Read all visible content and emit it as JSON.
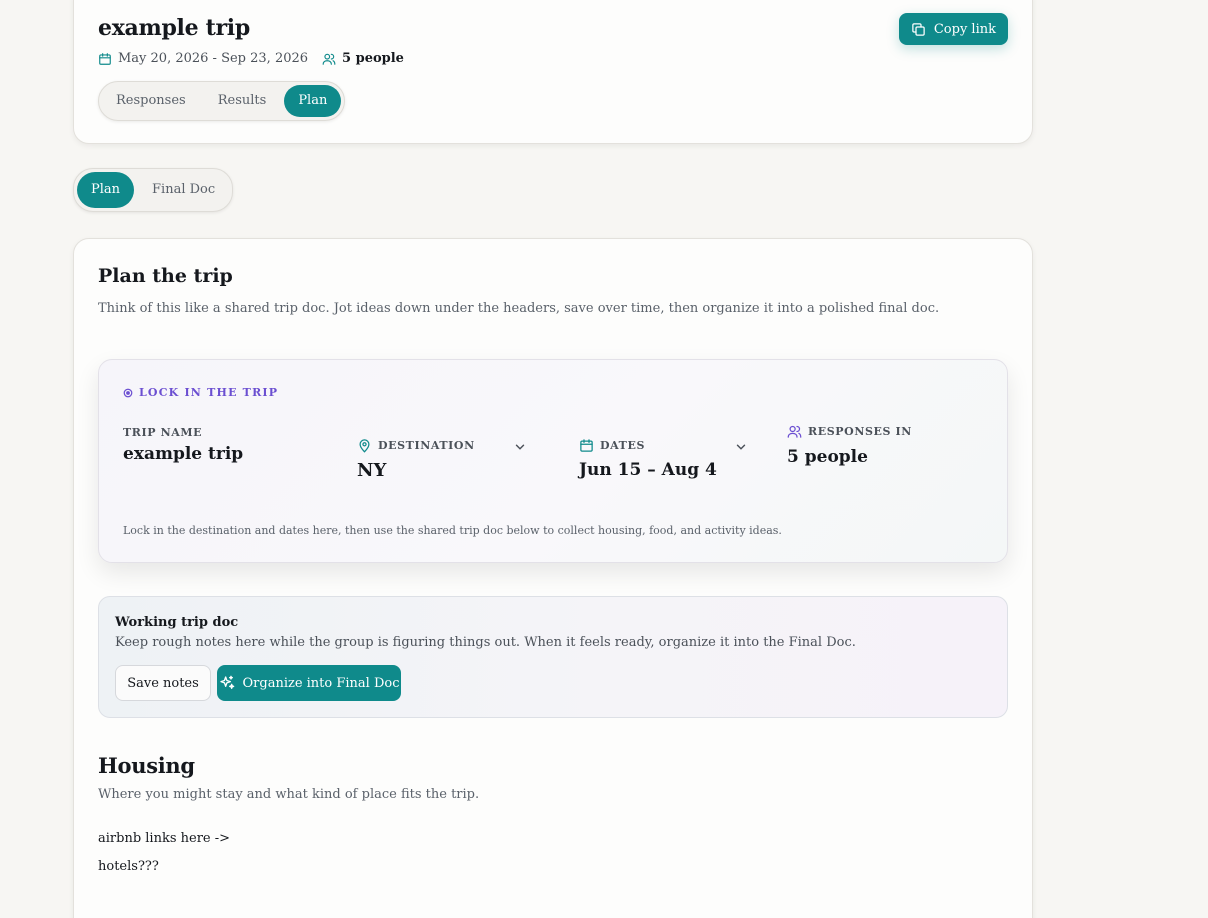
{
  "header": {
    "title": "example trip",
    "date_range": "May 20, 2026 - Sep 23, 2026",
    "people": "5 people",
    "copy_link_label": "Copy link",
    "tabs": [
      {
        "label": "Responses",
        "active": false
      },
      {
        "label": "Results",
        "active": false
      },
      {
        "label": "Plan",
        "active": true
      }
    ]
  },
  "subtabs": [
    {
      "label": "Plan",
      "active": true
    },
    {
      "label": "Final Doc",
      "active": false
    }
  ],
  "plan": {
    "title": "Plan the trip",
    "description": "Think of this like a shared trip doc. Jot ideas down under the headers, save over time, then organize it into a polished final doc."
  },
  "lock": {
    "label": "LOCK IN THE TRIP",
    "trip_name_label": "TRIP NAME",
    "trip_name_value": "example trip",
    "destination_label": "DESTINATION",
    "destination_value": "NY",
    "dates_label": "DATES",
    "dates_value": "Jun 15 – Aug 4",
    "responses_label": "RESPONSES IN",
    "responses_value": "5 people",
    "note": "Lock in the destination and dates here, then use the shared trip doc below to collect housing, food, and activity ideas."
  },
  "working_doc": {
    "title": "Working trip doc",
    "description": "Keep rough notes here while the group is figuring things out. When it feels ready, organize it into the Final Doc.",
    "save_label": "Save notes",
    "organize_label": "Organize into Final Doc"
  },
  "housing": {
    "title": "Housing",
    "description": "Where you might stay and what kind of place fits the trip.",
    "notes": [
      "airbnb links here ->",
      "hotels???"
    ]
  },
  "colors": {
    "accent": "#0f8a8b",
    "lock_label": "#6b4fd1",
    "background": "#f7f6f3"
  }
}
